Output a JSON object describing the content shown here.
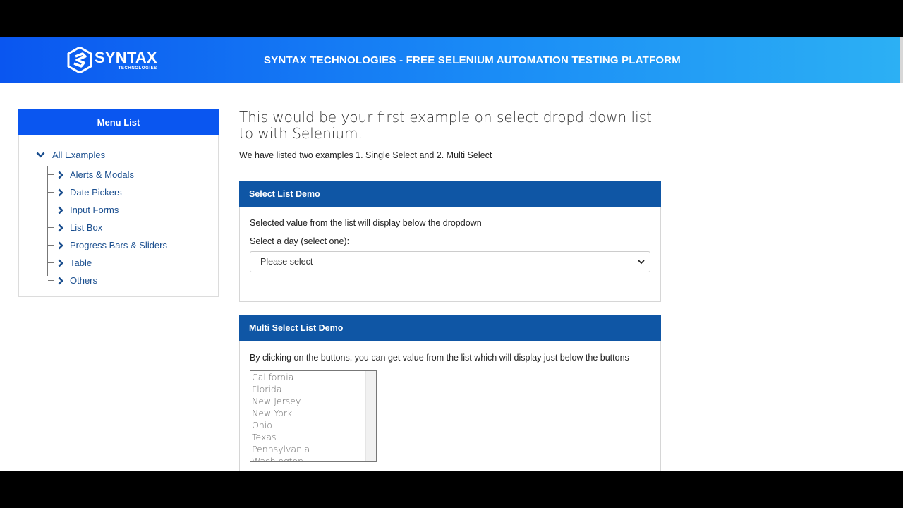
{
  "header": {
    "logo_text": "SYNTAX",
    "logo_subtext": "TECHNOLOGIES",
    "title": "SYNTAX TECHNOLOGIES - FREE SELENIUM AUTOMATION TESTING PLATFORM"
  },
  "menu": {
    "title": "Menu List",
    "root": "All Examples",
    "items": [
      {
        "label": "Alerts & Modals"
      },
      {
        "label": "Date Pickers"
      },
      {
        "label": "Input Forms"
      },
      {
        "label": "List Box"
      },
      {
        "label": "Progress Bars & Sliders"
      },
      {
        "label": "Table"
      },
      {
        "label": "Others"
      }
    ]
  },
  "main": {
    "title": "This would be your first example on select dropd down list to with Selenium.",
    "subtitle": "We have listed two examples 1. Single Select and 2. Multi Select"
  },
  "select_demo": {
    "header": "Select List Demo",
    "description": "Selected value from the list will display below the dropdown",
    "label": "Select a day (select one):",
    "selected": "Please select"
  },
  "multi_demo": {
    "header": "Multi Select List Demo",
    "description": "By clicking on the buttons, you can get value from the list which will display just below the buttons",
    "options": [
      "California",
      "Florida",
      "New Jersey",
      "New York",
      "Ohio",
      "Texas",
      "Pennsylvania",
      "Washington"
    ]
  },
  "colors": {
    "brand_blue": "#0a56f0",
    "panel_header": "#0f56a5",
    "link": "#1b4f8f"
  }
}
